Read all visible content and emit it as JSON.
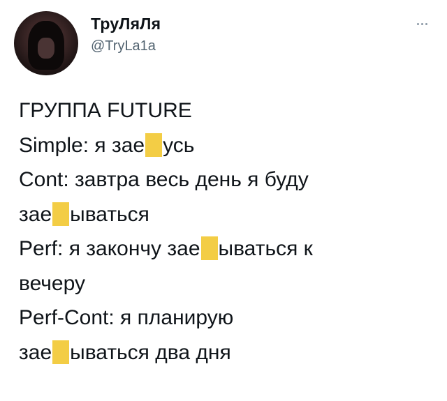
{
  "author": {
    "display_name": "ТруЛяЛя",
    "handle": "@TryLa1a"
  },
  "tweet": {
    "lines": [
      {
        "a": "ГРУППА FUTURE",
        "b": ""
      },
      {
        "a": "Simple: я зае",
        "b": "усь"
      },
      {
        "a": "Cont: завтра весь день я буду",
        "b": ""
      },
      {
        "a": "зае",
        "b": "ываться"
      },
      {
        "a": "Perf: я закончу зае",
        "b": "ываться к"
      },
      {
        "a": "вечеру",
        "b": ""
      },
      {
        "a": "Perf-Cont: я планирую",
        "b": ""
      },
      {
        "a": "зае",
        "b": "ываться два дня"
      }
    ]
  },
  "colors": {
    "censor_highlight": "#f3cd45",
    "handle_gray": "#536471",
    "text": "#0f1419"
  },
  "icons": {
    "more": "more-horizontal-icon"
  }
}
